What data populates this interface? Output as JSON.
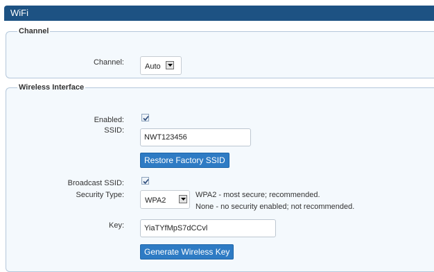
{
  "window": {
    "title": "WiFi"
  },
  "channel_section": {
    "legend": "Channel",
    "channel_label": "Channel:",
    "channel_value": "Auto"
  },
  "wireless_section": {
    "legend": "Wireless Interface",
    "enabled_label": "Enabled:",
    "enabled_checked": true,
    "ssid_label": "SSID:",
    "ssid_value": "NWT123456",
    "restore_button": "Restore Factory SSID",
    "broadcast_label": "Broadcast SSID:",
    "broadcast_checked": true,
    "security_label": "Security Type:",
    "security_value": "WPA2",
    "security_hint_1": "WPA2 - most secure; recommended.",
    "security_hint_2": "None - no security enabled; not recommended.",
    "key_label": "Key:",
    "key_value": "YiaTYfMpS7dCCvl",
    "generate_button": "Generate Wireless Key"
  },
  "colors": {
    "titlebar": "#1d5283",
    "section_bg": "#f4f9fd",
    "button_bg": "#2e7bc4"
  }
}
